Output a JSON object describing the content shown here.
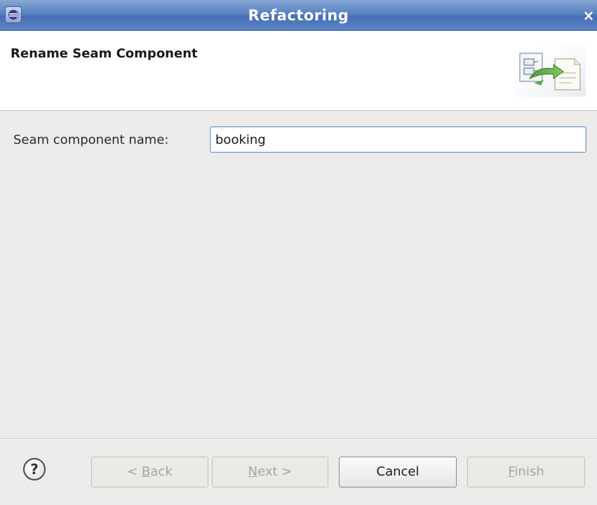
{
  "window": {
    "title": "Refactoring",
    "close_glyph": "×",
    "app_icon": "eclipse-icon"
  },
  "banner": {
    "title": "Rename Seam Component",
    "icon": "rename-refactoring-icon"
  },
  "form": {
    "label": "Seam component name:",
    "value": "booking"
  },
  "buttons": {
    "help_glyph": "?",
    "back": {
      "pre": "< ",
      "mnemonic": "B",
      "post": "ack",
      "enabled": false
    },
    "next": {
      "pre": "",
      "mnemonic": "N",
      "post": "ext >",
      "enabled": false
    },
    "cancel": {
      "label": "Cancel",
      "enabled": true
    },
    "finish": {
      "pre": "",
      "mnemonic": "F",
      "post": "inish",
      "enabled": false
    }
  },
  "colors": {
    "titlebar": "#5a82c2",
    "dialog_bg": "#edeceb",
    "input_border": "#7fa2cc"
  }
}
